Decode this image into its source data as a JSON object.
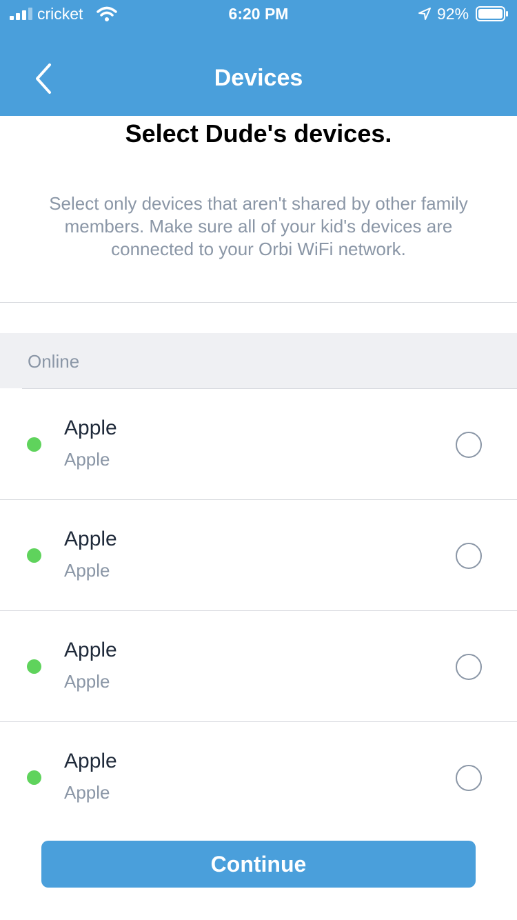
{
  "status_bar": {
    "carrier": "cricket",
    "time": "6:20 PM",
    "battery_percent": "92%",
    "icons": [
      "signal-icon",
      "wifi-icon",
      "location-arrow-icon",
      "battery-icon"
    ]
  },
  "nav": {
    "title": "Devices",
    "back_icon": "chevron-left-icon"
  },
  "page": {
    "title": "Select Dude's devices.",
    "instructions": "Select only devices that aren't shared by other family members. Make sure all of your kid's devices are connected to your Orbi WiFi network."
  },
  "section": {
    "label": "Online"
  },
  "devices": [
    {
      "name": "Apple",
      "vendor": "Apple",
      "status": "online",
      "selected": false
    },
    {
      "name": "Apple",
      "vendor": "Apple",
      "status": "online",
      "selected": false
    },
    {
      "name": "Apple",
      "vendor": "Apple",
      "status": "online",
      "selected": false
    },
    {
      "name": "Apple",
      "vendor": "Apple",
      "status": "online",
      "selected": false
    }
  ],
  "continue_label": "Continue",
  "colors": {
    "brand_blue": "#4a9fdb",
    "online_green": "#5fd35c",
    "secondary_text": "#8a96a6",
    "section_bg": "#eff0f3"
  }
}
